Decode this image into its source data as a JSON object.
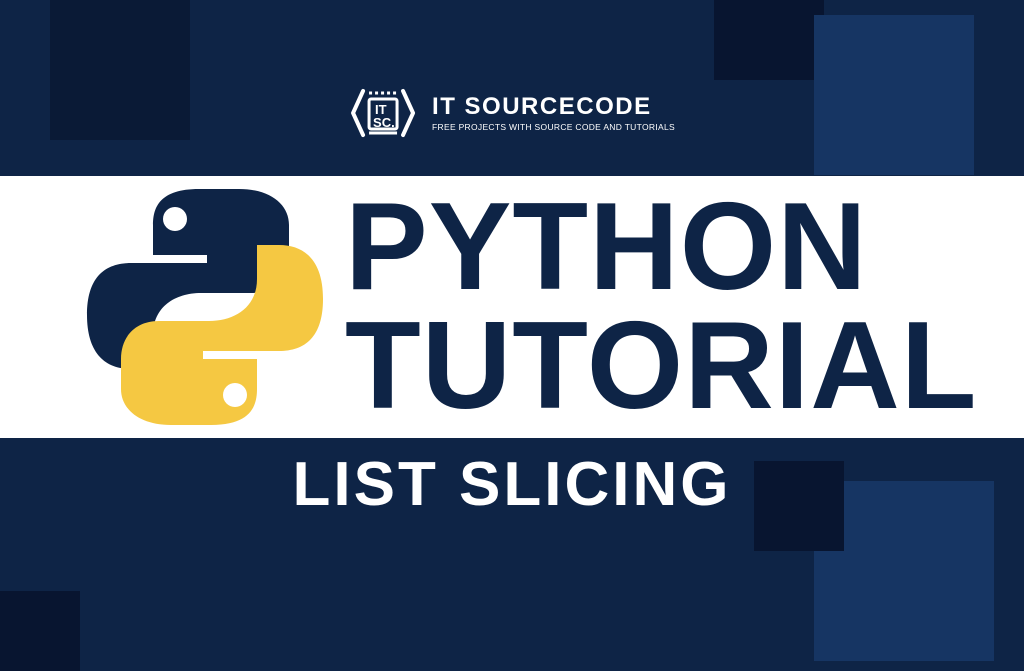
{
  "brand": {
    "title": "IT SOURCECODE",
    "subtitle": "FREE PROJECTS WITH SOURCE CODE AND TUTORIALS"
  },
  "main": {
    "titleLine1": "PYTHON",
    "titleLine2": "TUTORIAL"
  },
  "subtitle": "LIST SLICING",
  "colors": {
    "background": "#0e2446",
    "accent": "#f5c842",
    "text": "#0e2446",
    "subtitle_text": "#ffffff"
  }
}
